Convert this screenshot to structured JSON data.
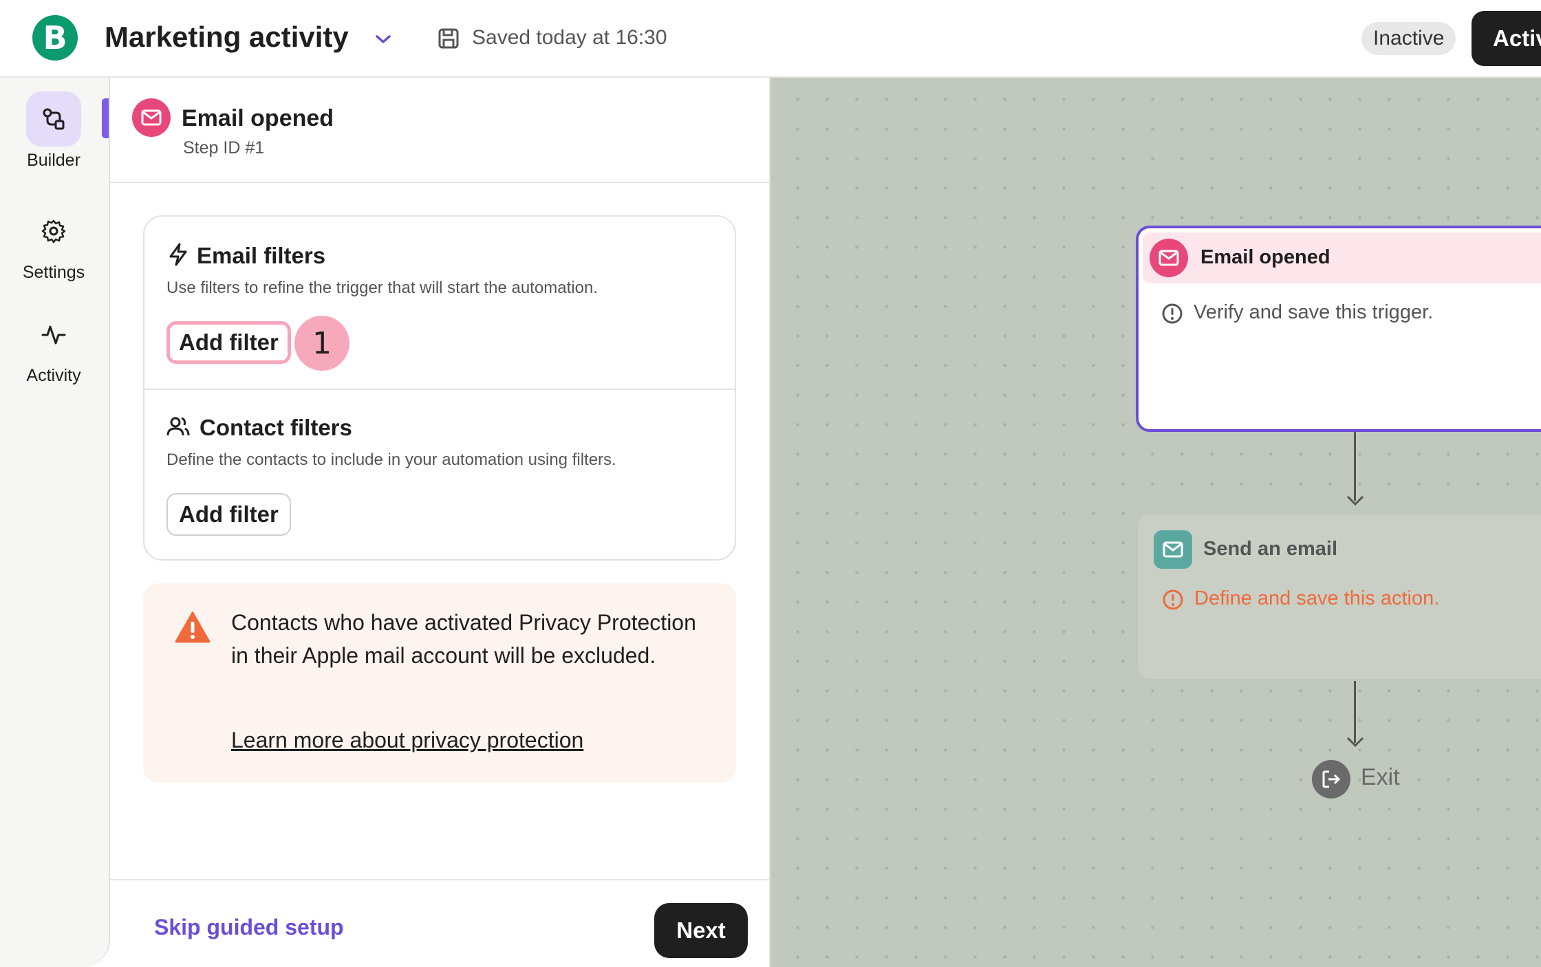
{
  "header": {
    "logo_letter": "B",
    "title": "Marketing activity",
    "saved_status": "Saved today at 16:30",
    "status_badge": "Inactive",
    "activate_label": "Activate"
  },
  "sidebar": {
    "items": [
      {
        "label": "Builder",
        "icon": "builder-icon",
        "active": true
      },
      {
        "label": "Settings",
        "icon": "gear-icon",
        "active": false
      },
      {
        "label": "Activity",
        "icon": "activity-icon",
        "active": false
      }
    ]
  },
  "panel": {
    "title": "Email opened",
    "step_id": "Step ID #1",
    "email_filters": {
      "title": "Email filters",
      "description": "Use filters to refine the trigger that will start the automation.",
      "button": "Add filter",
      "step_marker": "1"
    },
    "contact_filters": {
      "title": "Contact filters",
      "description": "Define the contacts to include in your automation using filters.",
      "button": "Add filter"
    },
    "warning": {
      "text": "Contacts who have activated Privacy Protection in their Apple mail account will be excluded.",
      "link": "Learn more about privacy protection"
    },
    "footer": {
      "skip": "Skip guided setup",
      "next": "Next"
    }
  },
  "canvas": {
    "trigger_node": {
      "title": "Email opened",
      "message": "Verify and save this trigger."
    },
    "action_node": {
      "title": "Send an email",
      "message": "Define and save this action."
    },
    "exit_label": "Exit"
  },
  "colors": {
    "brand_green": "#0b996e",
    "accent_purple": "#6a4fd6",
    "trigger_pink": "#e8477a",
    "email_teal": "#5aa8a0",
    "warning_orange": "#f06a3c"
  }
}
